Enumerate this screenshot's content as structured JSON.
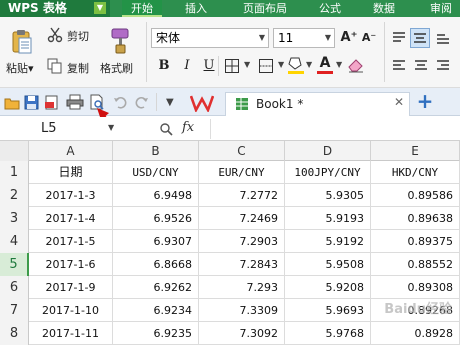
{
  "app": {
    "name": "WPS 表格",
    "dropdown_glyph": "▼"
  },
  "menu": [
    "开始",
    "插入",
    "页面布局",
    "公式",
    "数据",
    "审阅"
  ],
  "ribbon": {
    "paste_label": "粘贴",
    "paste_arrow": "▾",
    "cut_label": "剪切",
    "copy_label": "复制",
    "format_painter_label": "格式刷",
    "font_name": "宋体",
    "font_size": "11",
    "bold": "B",
    "italic": "I",
    "underline": "U",
    "grow_font": "A⁺",
    "shrink_font": "A⁻",
    "font_color_letter": "A"
  },
  "quickbar": {
    "doc_tab": "Book1 *",
    "close_glyph": "✕",
    "new_tab_glyph": "+"
  },
  "formula_bar": {
    "name_box": "L5",
    "fx_label": "fx",
    "value": ""
  },
  "sheet": {
    "columns": [
      "A",
      "B",
      "C",
      "D",
      "E"
    ],
    "header_row": {
      "num": "1",
      "cells": [
        "日期",
        "USD/CNY",
        "EUR/CNY",
        "100JPY/CNY",
        "HKD/CNY"
      ]
    },
    "rows": [
      {
        "num": "2",
        "cells": [
          "2017-1-3",
          "6.9498",
          "7.2772",
          "5.9305",
          "0.89586"
        ]
      },
      {
        "num": "3",
        "cells": [
          "2017-1-4",
          "6.9526",
          "7.2469",
          "5.9193",
          "0.89638"
        ]
      },
      {
        "num": "4",
        "cells": [
          "2017-1-5",
          "6.9307",
          "7.2903",
          "5.9192",
          "0.89375"
        ]
      },
      {
        "num": "5",
        "cells": [
          "2017-1-6",
          "6.8668",
          "7.2843",
          "5.9508",
          "0.88552"
        ]
      },
      {
        "num": "6",
        "cells": [
          "2017-1-9",
          "6.9262",
          "7.293",
          "5.9208",
          "0.89308"
        ]
      },
      {
        "num": "7",
        "cells": [
          "2017-1-10",
          "6.9234",
          "7.3309",
          "5.9693",
          "0.89268"
        ]
      },
      {
        "num": "8",
        "cells": [
          "2017-1-11",
          "6.9235",
          "7.3092",
          "5.9768",
          "0.8928"
        ]
      }
    ]
  },
  "watermark": "Baidu经验",
  "colors": {
    "menubar": "#2d8f4e",
    "accent": "#7dc043",
    "arrow": "#d01010"
  }
}
